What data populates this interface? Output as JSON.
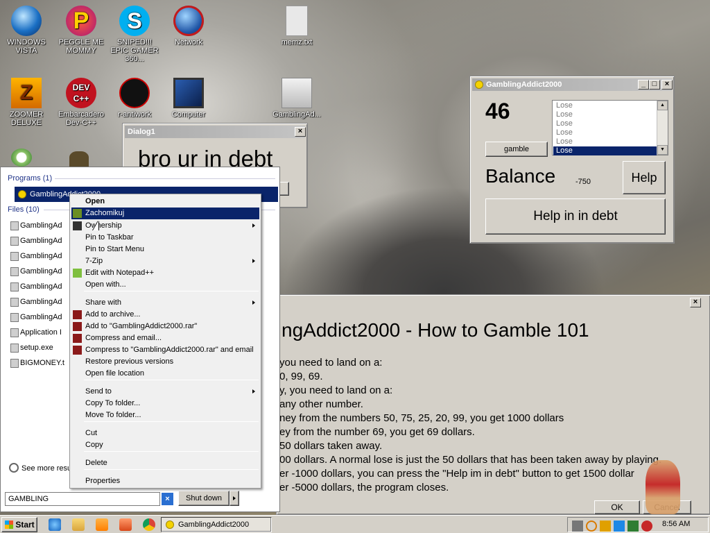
{
  "desktop": {
    "icons": [
      {
        "label": "WINDOWS VISTA"
      },
      {
        "label": "PEGGLE ME MOMMY"
      },
      {
        "label": "SNIPED!!! EPIC GAMER 360..."
      },
      {
        "label": "Network"
      },
      {
        "label": "memz.txt"
      },
      {
        "label": "ZOOMER DELUXE"
      },
      {
        "label": "Embarcadero Dev-C++"
      },
      {
        "label": "r-antiwork"
      },
      {
        "label": "Computer"
      },
      {
        "label": "GamblingAd..."
      }
    ]
  },
  "dialog1": {
    "title": "Dialog1",
    "message": "bro ur in debt"
  },
  "gambling_window": {
    "title": "GamblingAddict2000",
    "number": "46",
    "gamble_label": "gamble",
    "results": [
      "Lose",
      "Lose",
      "Lose",
      "Lose",
      "Lose",
      "Lose"
    ],
    "balance_label": "Balance",
    "balance_value": "-750",
    "help_label": "Help",
    "help_debt_label": "Help in in debt"
  },
  "help_window": {
    "heading": "ngAddict2000 - How to Gamble 101",
    "lines": [
      "you need to land on a:",
      "0, 99, 69.",
      "y, you need to land on a:",
      "any other number.",
      "ney from the numbers 50, 75, 25, 20, 99, you get 1000 dollars",
      "ey from the number 69, you get 69 dollars.",
      "50 dollars taken away.",
      "00 dollars. A normal lose is just the 50 dollars that has been taken away by playing.",
      "er -1000 dollars, you can press the \"Help im in debt\" button to get 1500 dollar",
      "er -5000 dollars, the program closes."
    ],
    "ok_label": "OK",
    "cancel_label": "Cancel"
  },
  "start_menu": {
    "programs_header": "Programs (1)",
    "program_item": "GamblingAddict2000",
    "files_header": "Files (10)",
    "files": [
      "GamblingAd",
      "GamblingAd",
      "GamblingAd",
      "GamblingAd",
      "GamblingAd",
      "GamblingAd",
      "GamblingAd",
      "Application I",
      "setup.exe",
      "BIGMONEY.t"
    ],
    "see_more": "See more resu",
    "search_value": "GAMBLING",
    "shutdown_label": "Shut down"
  },
  "context_menu": {
    "items": [
      {
        "label": "Open",
        "bold": true
      },
      {
        "label": "Zachomikuj",
        "selected": true
      },
      {
        "label": "Ownership",
        "submenu": true
      },
      {
        "label": "Pin to Taskbar"
      },
      {
        "label": "Pin to Start Menu"
      },
      {
        "label": "7-Zip",
        "submenu": true
      },
      {
        "label": "Edit with Notepad++"
      },
      {
        "label": "Open with..."
      },
      {
        "label": "Share with",
        "submenu": true
      },
      {
        "label": "Add to archive..."
      },
      {
        "label": "Add to \"GamblingAddict2000.rar\""
      },
      {
        "label": "Compress and email..."
      },
      {
        "label": "Compress to \"GamblingAddict2000.rar\" and email"
      },
      {
        "label": "Restore previous versions"
      },
      {
        "label": "Open file location"
      },
      {
        "label": "Send to",
        "submenu": true
      },
      {
        "label": "Copy To folder..."
      },
      {
        "label": "Move To folder..."
      },
      {
        "label": "Cut"
      },
      {
        "label": "Copy"
      },
      {
        "label": "Delete"
      },
      {
        "label": "Properties"
      }
    ]
  },
  "taskbar": {
    "start_label": "Start",
    "active_task": "GamblingAddict2000",
    "clock": "8:56 AM"
  }
}
